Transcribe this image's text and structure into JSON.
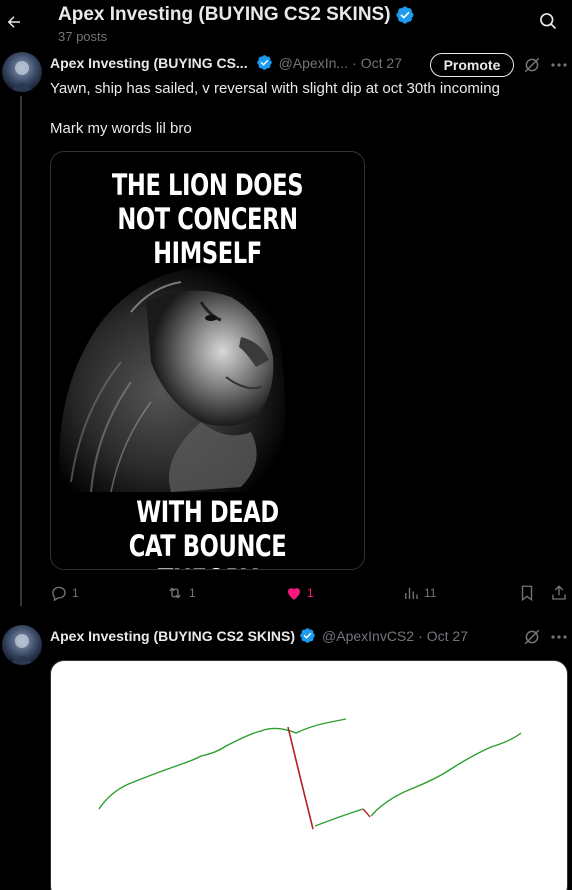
{
  "header": {
    "title": "Apex Investing (BUYING CS2 SKINS)",
    "post_count": "37 posts"
  },
  "tweet1": {
    "name": "Apex Investing (BUYING CS...",
    "handle": "@ApexIn...",
    "dot": "·",
    "date": "Oct 27",
    "promote_label": "Promote",
    "line1": "Yawn, ship has sailed, v reversal with slight dip at oct 30th incoming",
    "line2": "Mark my words lil bro",
    "meme": {
      "top_line1": "THE LION DOES",
      "top_line2": "NOT CONCERN HIMSELF",
      "bottom_line1": "WITH DEAD",
      "bottom_line2": "CAT BOUNCE THEORY"
    },
    "stats": {
      "replies": "1",
      "reposts": "1",
      "likes": "1",
      "views": "11"
    }
  },
  "tweet2": {
    "name": "Apex Investing (BUYING CS2 SKINS)",
    "handle": "@ApexInvCS2",
    "dot": "·",
    "date": "Oct 27"
  },
  "colors": {
    "accent_blue": "#1d9bf0",
    "like_pink": "#f91880",
    "muted": "#71767b",
    "line_green": "#2ca02c",
    "line_red": "#b22222"
  },
  "icons": [
    "back-arrow-icon",
    "search-icon",
    "verified-badge-icon",
    "grok-icon",
    "more-icon",
    "reply-icon",
    "repost-icon",
    "like-icon",
    "views-icon",
    "bookmark-icon",
    "share-icon"
  ]
}
